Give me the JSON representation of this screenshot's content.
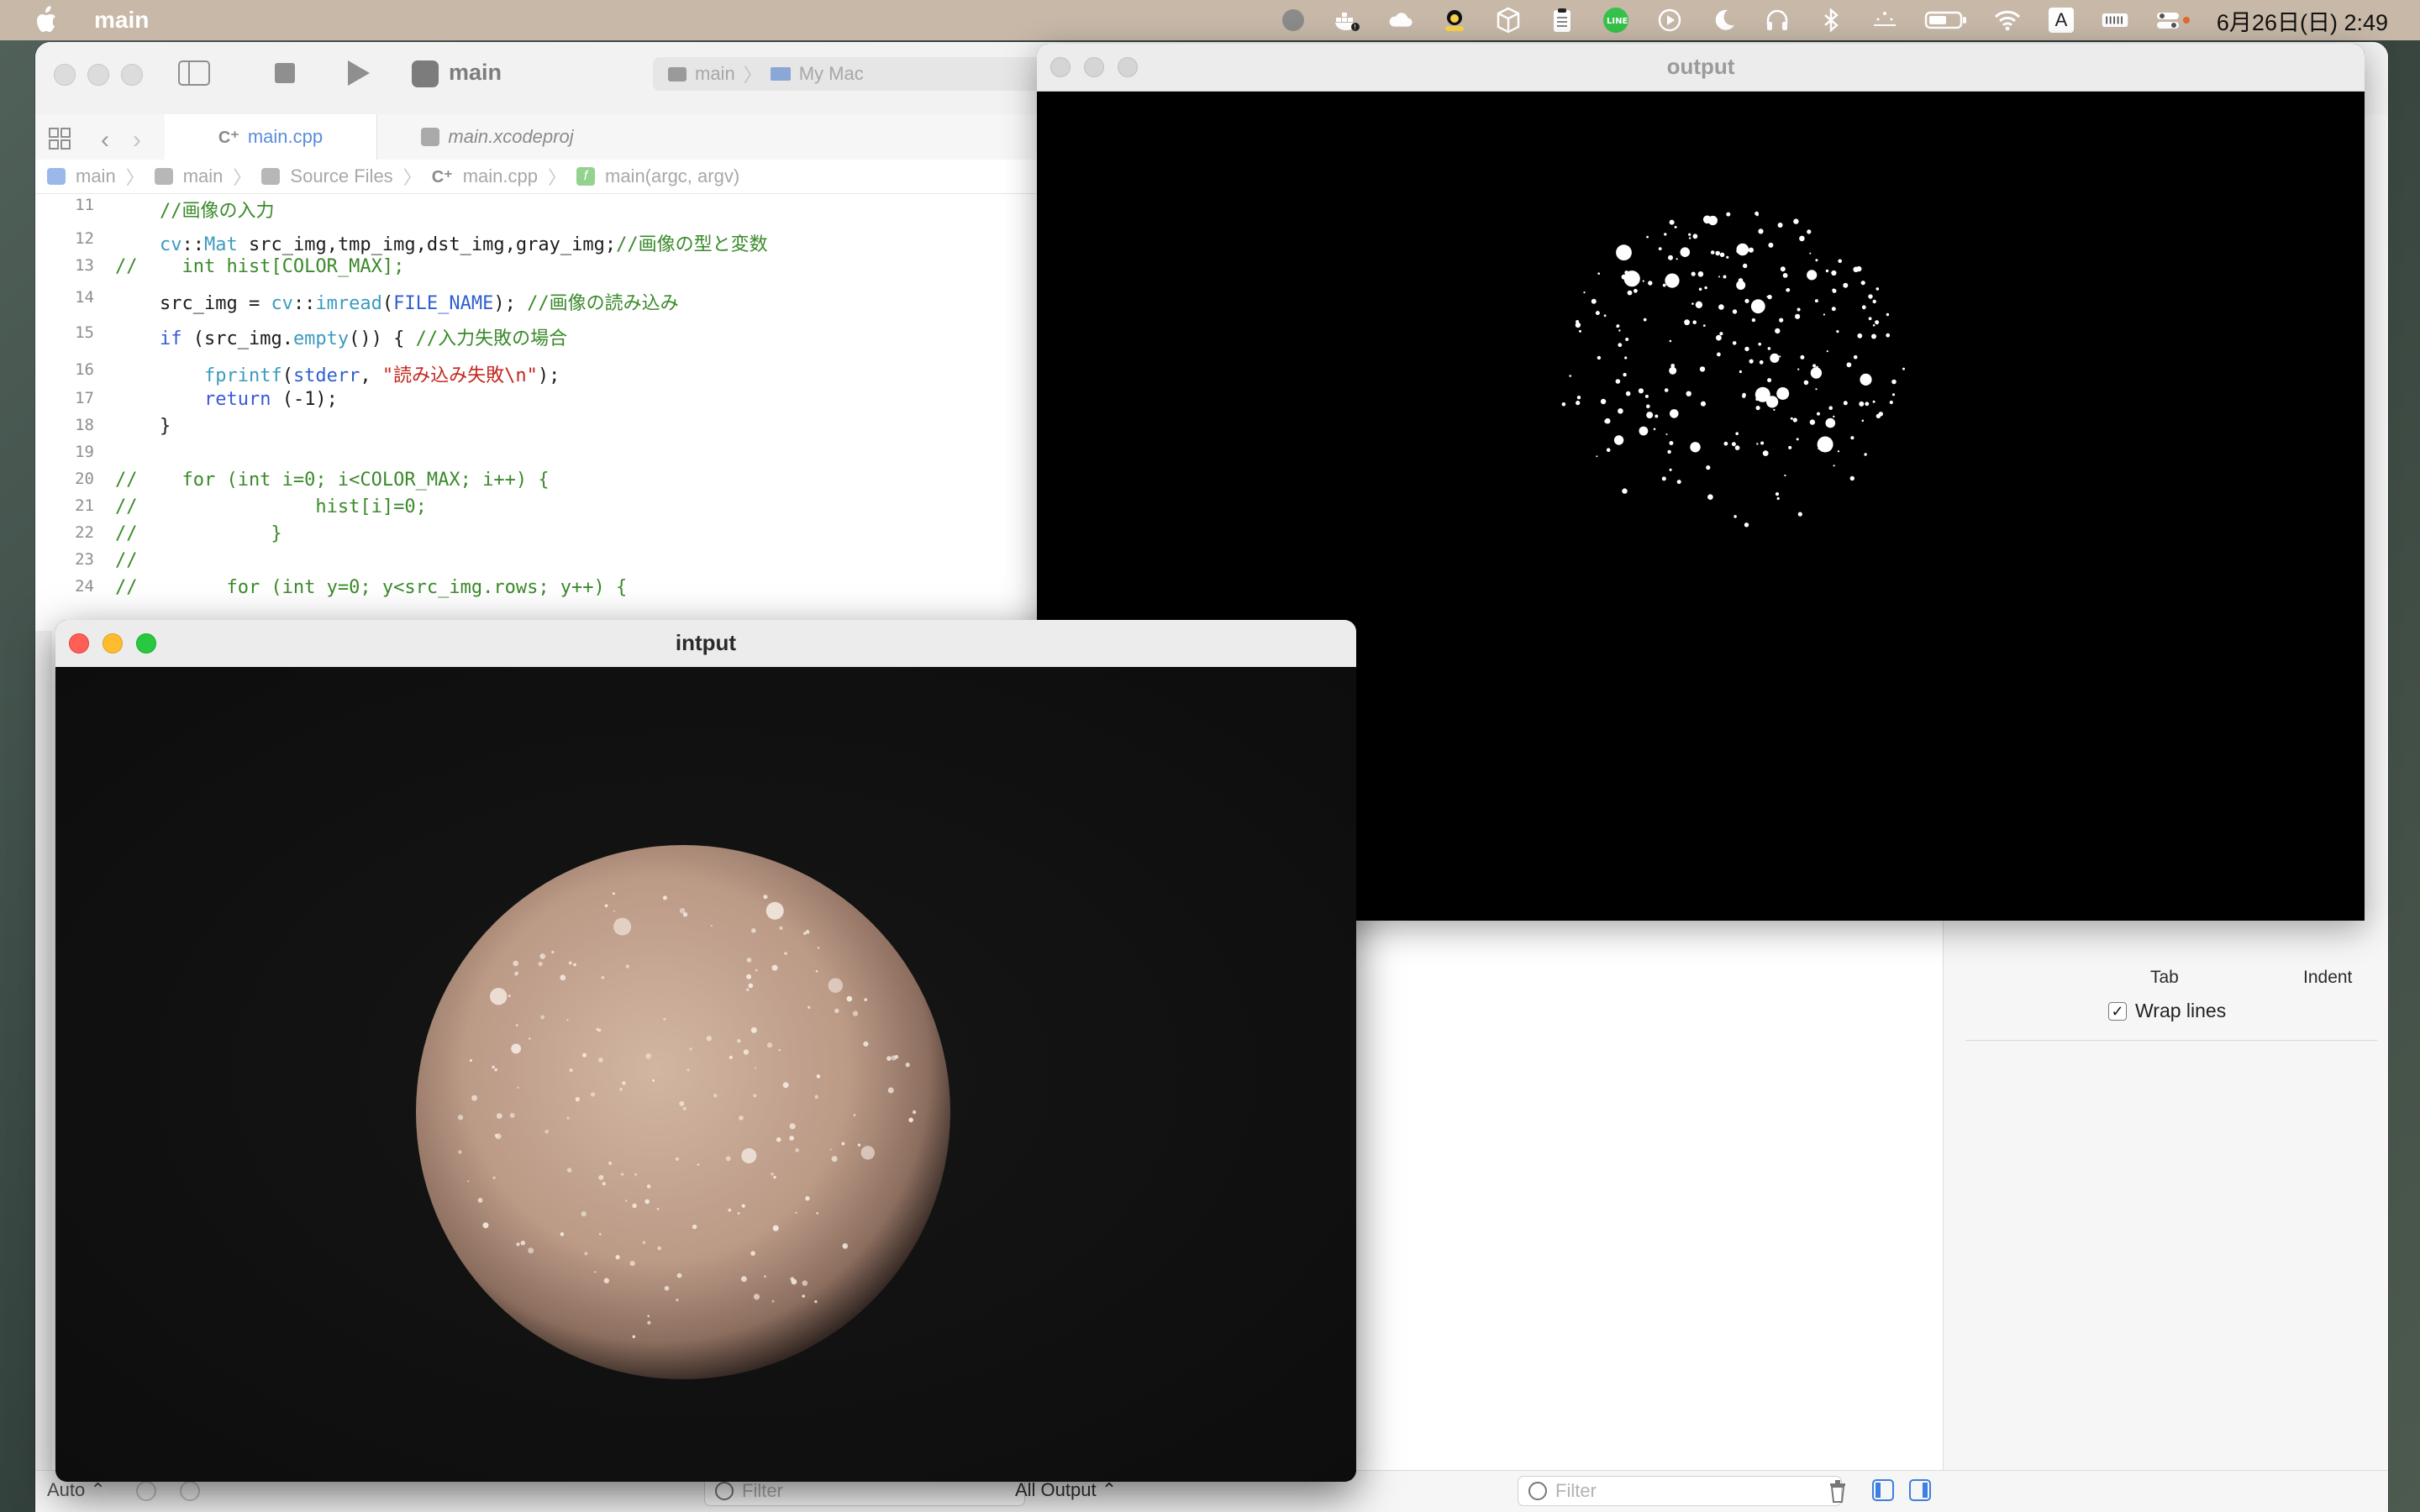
{
  "menubar": {
    "app_name": "main",
    "clock": "6月26日(日) 2:49",
    "input_source": "A"
  },
  "xcode": {
    "toolbar": {
      "scheme_title": "main",
      "destination_scheme": "main",
      "destination_device": "My Mac"
    },
    "tabs": [
      {
        "prefix": "C⁺",
        "label": "main.cpp"
      },
      {
        "label": "main.xcodeproj"
      }
    ],
    "jumpbar": [
      "main",
      "main",
      "Source Files",
      "main.cpp",
      "main(argc, argv)"
    ],
    "jumpbar_prefix_cpp": "C⁺",
    "code_lines": [
      {
        "n": "11",
        "t": "    //画像の入力"
      },
      {
        "n": "12",
        "t": "    cv::Mat src_img,tmp_img,dst_img,gray_img;//画像の型と変数"
      },
      {
        "n": "13",
        "t": "//    int hist[COLOR_MAX];"
      },
      {
        "n": "14",
        "t": "    src_img = cv::imread(FILE_NAME); //画像の読み込み"
      },
      {
        "n": "15",
        "t": "    if (src_img.empty()) { //入力失敗の場合"
      },
      {
        "n": "16",
        "t": "        fprintf(stderr, \"読み込み失敗\\n\");"
      },
      {
        "n": "17",
        "t": "        return (-1);"
      },
      {
        "n": "18",
        "t": "    }"
      },
      {
        "n": "19",
        "t": ""
      },
      {
        "n": "20",
        "t": "//    for (int i=0; i<COLOR_MAX; i++) {"
      },
      {
        "n": "21",
        "t": "//                hist[i]=0;"
      },
      {
        "n": "22",
        "t": "//            }"
      },
      {
        "n": "23",
        "t": "//"
      },
      {
        "n": "24",
        "t": "//        for (int y=0; y<src_img.rows; y++) {"
      }
    ],
    "inspector": {
      "tab_label": "Tab",
      "indent_label": "Indent",
      "wrap_lines_label": "Wrap lines",
      "wrap_lines_checked": true
    },
    "bottombar": {
      "auto_label": "Auto ⌃",
      "filter_placeholder": "Filter",
      "all_output_label": "All Output ⌃",
      "filter_placeholder_right": "Filter"
    }
  },
  "windows": {
    "output_title": "output",
    "input_title": "intput"
  },
  "colors": {
    "menubar_bg": "#c7b8a8",
    "sphere_color": "#c4a48e",
    "accent_blue": "#3f7fe0"
  }
}
